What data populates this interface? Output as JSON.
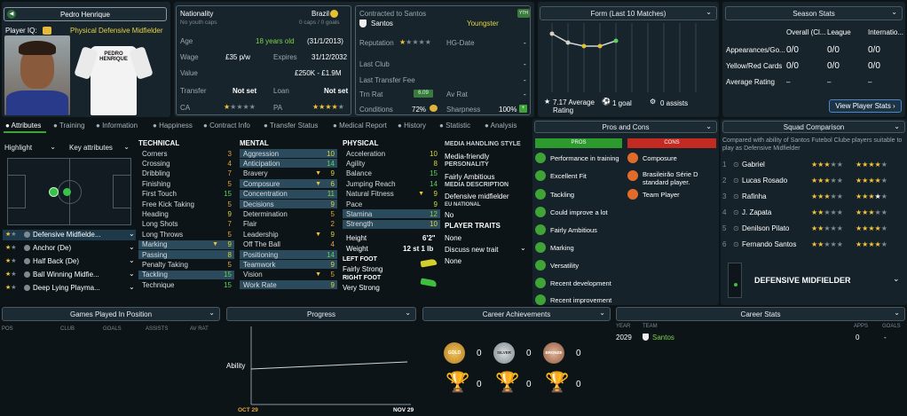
{
  "player": {
    "name": "Pedro Henrique",
    "iq_label": "Player IQ:",
    "position_label": "Physical Defensive Midfielder",
    "shirt_name": "PEDRO HENRIQUE"
  },
  "info": {
    "nationality_label": "Nationality",
    "nationality": "Brazil",
    "caps_label": "No youth caps",
    "caps": "0 caps / 0 goals",
    "age_label": "Age",
    "age": "18 years old",
    "dob": "(31/1/2013)",
    "wage_label": "Wage",
    "wage": "£35 p/w",
    "expires_label": "Expires",
    "expires": "31/12/2032",
    "value_label": "Value",
    "value": "£250K - £1.9M",
    "transfer_label": "Transfer",
    "transfer": "Not set",
    "loan_label": "Loan",
    "loan": "Not set",
    "ca_label": "CA",
    "pa_label": "PA",
    "contracted_label": "Contracted to Santos",
    "club": "Santos",
    "youngster": "Youngster",
    "badge": "YTH",
    "rep_label": "Reputation",
    "hg_label": "HG-Date",
    "hg": "-",
    "last_club_label": "Last Club",
    "last_club": "-",
    "last_fee_label": "Last Transfer Fee",
    "last_fee": "-",
    "trn_label": "Trn Rat",
    "trn": "6.09",
    "avrat_label": "Av Rat",
    "avrat": "-",
    "conditions_label": "Conditions",
    "conditions": "72%",
    "sharpness_label": "Sharpness",
    "sharpness": "100%"
  },
  "form": {
    "title": "Form (Last 10 Matches)",
    "avg": "7.17 Average Rating",
    "goals": "1 goal",
    "assists": "0 assists"
  },
  "season": {
    "title": "Season Stats",
    "cols": [
      "Overall (Cl...",
      "League",
      "Internatio..."
    ],
    "rows": [
      {
        "label": "Appearances/Go...",
        "vals": [
          "0/0",
          "0/0",
          "0/0"
        ]
      },
      {
        "label": "Yellow/Red Cards",
        "vals": [
          "0/0",
          "0/0",
          "0/0"
        ]
      },
      {
        "label": "Average Rating",
        "vals": [
          "–",
          "–",
          "–"
        ]
      }
    ],
    "button": "View Player Stats"
  },
  "tabs": [
    "Attributes",
    "Training",
    "Information",
    "Happiness",
    "Contract Info",
    "Transfer Status",
    "Medical Report",
    "History",
    "Statistic",
    "Analysis"
  ],
  "pitch": {
    "highlight": "Highlight",
    "key": "Key attributes"
  },
  "roles": [
    "Defensive Midfielde...",
    "Anchor (De)",
    "Half Back (De)",
    "Ball Winning Midfie...",
    "Deep Lying Playma..."
  ],
  "technical": {
    "title": "TECHNICAL",
    "items": [
      [
        "Corners",
        "3"
      ],
      [
        "Crossing",
        "4"
      ],
      [
        "Dribbling",
        "7"
      ],
      [
        "Finishing",
        "5"
      ],
      [
        "First Touch",
        "15"
      ],
      [
        "Free Kick Taking",
        "5"
      ],
      [
        "Heading",
        "9"
      ],
      [
        "Long Shots",
        "7"
      ],
      [
        "Long Throws",
        "5"
      ],
      [
        "Marking",
        "9"
      ],
      [
        "Passing",
        "8"
      ],
      [
        "Penalty Taking",
        "5"
      ],
      [
        "Tackling",
        "15"
      ],
      [
        "Technique",
        "15"
      ]
    ]
  },
  "mental": {
    "title": "MENTAL",
    "items": [
      [
        "Aggression",
        "10"
      ],
      [
        "Anticipation",
        "14"
      ],
      [
        "Bravery",
        "9"
      ],
      [
        "Composure",
        "6"
      ],
      [
        "Concentration",
        "11"
      ],
      [
        "Decisions",
        "9"
      ],
      [
        "Determination",
        "5"
      ],
      [
        "Flair",
        "2"
      ],
      [
        "Leadership",
        "9"
      ],
      [
        "Off The Ball",
        "4"
      ],
      [
        "Positioning",
        "14"
      ],
      [
        "Teamwork",
        "9"
      ],
      [
        "Vision",
        "5"
      ],
      [
        "Work Rate",
        "9"
      ]
    ]
  },
  "physical": {
    "title": "PHYSICAL",
    "items": [
      [
        "Acceleration",
        "10"
      ],
      [
        "Agility",
        "8"
      ],
      [
        "Balance",
        "15"
      ],
      [
        "Jumping Reach",
        "14"
      ],
      [
        "Natural Fitness",
        "9"
      ],
      [
        "Pace",
        "9"
      ],
      [
        "Stamina",
        "12"
      ],
      [
        "Strength",
        "10"
      ]
    ]
  },
  "bio": {
    "height_label": "Height",
    "height": "6'2\"",
    "weight_label": "Weight",
    "weight": "12 st 1 lb",
    "lf_label": "LEFT FOOT",
    "lf": "Fairly Strong",
    "rf_label": "RIGHT FOOT",
    "rf": "Very Strong"
  },
  "media": {
    "style_label": "MEDIA HANDLING STYLE",
    "style": "Media-friendly",
    "personality_label": "PERSONALITY",
    "personality": "Fairly Ambitious",
    "desc_label": "MEDIA DESCRIPTION",
    "desc": "Defensive midfielder",
    "eu_label": "EU NATIONAL",
    "eu": "No",
    "traits_label": "PLAYER TRAITS",
    "traits": "None",
    "discuss": "Discuss new trait",
    "none2": "None"
  },
  "proscons": {
    "title": "Pros and Cons",
    "pros_label": "PROS",
    "cons_label": "CONS",
    "pros": [
      "Performance in training",
      "Excellent Fit",
      "Tackling",
      "Could improve a lot",
      "Fairly Ambitious",
      "Marking",
      "Versatility",
      "Recent development",
      "Recent improvement"
    ],
    "cons": [
      "Composure",
      "Brasileirão Série D standard player.",
      "Team Player"
    ]
  },
  "squad": {
    "title": "Squad Comparison",
    "desc": "Compared with ability of Santos Futebol Clube players suitable to play as Defensive Midfielder",
    "players": [
      [
        "1",
        "Gabriel"
      ],
      [
        "2",
        "Lucas Rosado"
      ],
      [
        "3",
        "Rafinha"
      ],
      [
        "4",
        "J. Zapata"
      ],
      [
        "5",
        "Denilson Pilato"
      ],
      [
        "6",
        "Fernando Santos"
      ]
    ],
    "role": "DEFENSIVE MIDFIELDER"
  },
  "games": {
    "title": "Games Played In Position",
    "cols": [
      "POS",
      "CLUB",
      "GOALS",
      "ASSISTS",
      "AV RAT"
    ]
  },
  "progress": {
    "title": "Progress",
    "ability": "Ability",
    "from": "OCT 29",
    "to": "NOV 29"
  },
  "career_ach": {
    "title": "Career Achievements",
    "gold": "GOLD",
    "silver": "SILVER",
    "bronze": "BRONZE",
    "counts": [
      "0",
      "0",
      "0",
      "0",
      "0",
      "0"
    ]
  },
  "career": {
    "title": "Career Stats",
    "cols": [
      "YEAR",
      "TEAM",
      "APPS",
      "GOALS"
    ],
    "year": "2029",
    "team": "Santos",
    "apps": "0",
    "goals": "-"
  }
}
